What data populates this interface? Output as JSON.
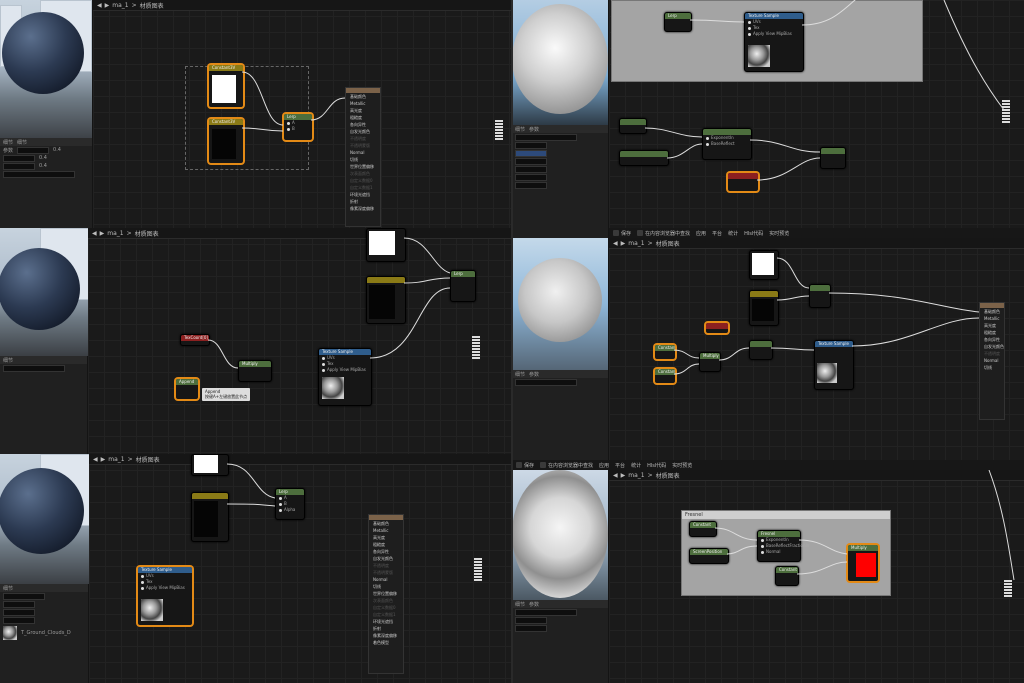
{
  "breadcrumb": {
    "item": "ma_1",
    "sep": ">",
    "graph": "材质图表"
  },
  "panel1": {
    "node_a": "Constant3V",
    "node_b": "Constant3V",
    "node_lerp": "Lerp",
    "menu_items": [
      "基础颜色",
      "Metallic",
      "高光度",
      "粗糙度",
      "各向异性",
      "自发光颜色",
      "不透明度",
      "不透明蒙版",
      "Normal",
      "切线",
      "世界位置偏移",
      "",
      "次表面颜色",
      "自定义数据0",
      "自定义数据1",
      "环境光遮挡",
      "折射",
      "",
      "像素深度偏移",
      "",
      "着色模型"
    ],
    "props_header": "细节",
    "props_rows": [
      [
        "参数",
        "0.4"
      ],
      [
        "",
        "0.4"
      ],
      [
        "",
        "0.4"
      ]
    ]
  },
  "panel2": {
    "node_a": "Lerp",
    "node_b": "Texture Sample",
    "tex_pins": [
      "UVs",
      "Tex",
      "Apply View MipBias"
    ],
    "tex_out": [
      "RGB",
      "R",
      "G",
      "B",
      "A",
      "RGBA"
    ],
    "toolbar": [
      "保存",
      "在内容浏览器中查找",
      "应用",
      "平台",
      "统计",
      "Hlsl代码",
      "实时预览"
    ]
  },
  "panel3": {
    "node_texcoord": "TexCoord[0]",
    "node_multiply": "Multiply",
    "node_append": "Append",
    "tip_title": "Append",
    "tip_body": "按键A+左键放置此节点",
    "node_tex": "Texture Sample",
    "tex_pins": [
      "UVs",
      "Tex",
      "Apply View MipBias"
    ],
    "node_lerp": "Lerp"
  },
  "panel4": {
    "node_a": "Constant",
    "node_b": "Constant",
    "node_mult": "Multiply",
    "node_tex": "Texture Sample",
    "output_items": [
      "基础颜色",
      "Metallic",
      "高光度",
      "粗糙度",
      "各向异性",
      "自发光颜色",
      "不透明度",
      "",
      "Normal",
      "切线"
    ]
  },
  "panel5": {
    "node_lerp": "Lerp",
    "node_tex": "Texture Sample",
    "tex_pins": [
      "UVs",
      "Tex",
      "Apply View MipBias"
    ],
    "menu_items": [
      "基础颜色",
      "Metallic",
      "高光度",
      "粗糙度",
      "各向异性",
      "自发光颜色",
      "不透明度",
      "不透明蒙版",
      "Normal",
      "切线",
      "世界位置偏移",
      "",
      "次表面颜色",
      "自定义数据0",
      "自定义数据1",
      "环境光遮挡",
      "折射",
      "",
      "像素深度偏移",
      "",
      "着色模型"
    ],
    "detail_texture": "T_Ground_Clouds_D"
  },
  "panel6": {
    "comment": "Fresnel",
    "node_1": "Constant",
    "node_2": "ScreenPosition",
    "node_3": "Fresnel",
    "node_3_pins": [
      "Exponentln",
      "BaseReflectFractionIn",
      "Normal"
    ],
    "node_4": "Multiply",
    "node_5": "Constant",
    "toolbar": [
      "保存",
      "在内容浏览器中查找",
      "应用",
      "平台",
      "统计",
      "Hlsl代码",
      "实时预览"
    ]
  },
  "shared": {
    "details_tab": "细节",
    "param_tab": "参数",
    "search_placeholder": "搜索"
  },
  "colors": {
    "selection": "#e38a16",
    "accent_red": "#ff0000"
  }
}
